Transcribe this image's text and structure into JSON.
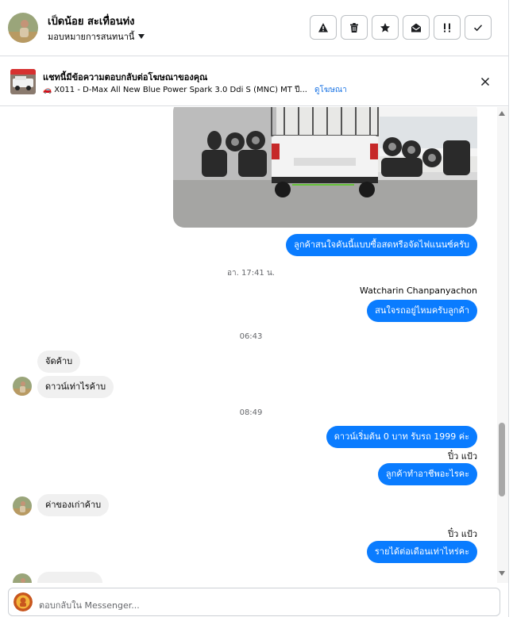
{
  "header": {
    "contact_name": "เป็ดน้อย สะเทื่อนท่ง",
    "assign_label": "มอบหมายการสนทนานี้",
    "actions": [
      "report-icon",
      "trash-icon",
      "star-icon",
      "envelope-open-icon",
      "follow-up-icon",
      "check-icon"
    ]
  },
  "ad_banner": {
    "title": "แชทนี้มีข้อความตอบกลับต่อโฆษณาของคุณ",
    "ad_name": "X011 - D-Max All New Blue Power Spark 3.0 Ddi S (MNC) MT ปี...",
    "link_label": "ดูโฆษณา"
  },
  "messages": {
    "m1": "ลูกค้าสนใจคันนี้แบบซื้อสดหรือจัดไฟแนนซ์ครับ",
    "ts1": "อา. 17:41 น.",
    "sender1": "Watcharin Chanpanyachon",
    "m2": "สนใจรถอยู่ไหมครับลูกค้า",
    "ts2": "06:43",
    "m3": "จัดค้าบ",
    "m4": "ดาวน์เท่าไรค้าบ",
    "ts3": "08:49",
    "m5": "ดาวน์เริ่มต้น 0 บาท รับรถ 1999 ค่ะ",
    "sender2": "ปิ๋ว แป้ว",
    "m6": "ลูกค้าทำอาชีพอะไรคะ",
    "m7": "ค่าของเก่าค้าบ",
    "sender3": "ปิ๋ว แป้ว",
    "m8": "รายได้ต่อเดือนเท่าไหร่คะ"
  },
  "composer": {
    "placeholder": "ตอบกลับใน Messenger..."
  },
  "colors": {
    "outgoing_bubble": "#0a7cff",
    "incoming_bubble": "#f0f0f0",
    "link": "#1b74e4"
  }
}
